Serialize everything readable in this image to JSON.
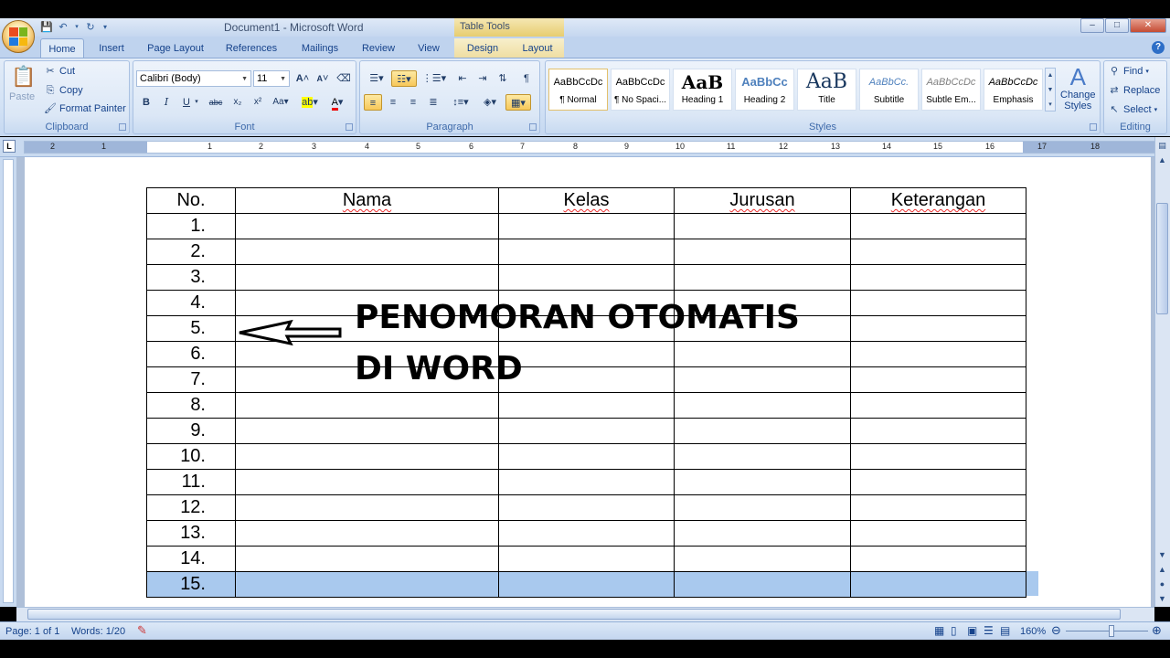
{
  "window": {
    "title_doc": "Document1",
    "title_sep": " - ",
    "title_app": "Microsoft Word",
    "table_tools": "Table Tools",
    "minimize": "–",
    "maximize": "□",
    "close": "✕"
  },
  "tabs": [
    "Home",
    "Insert",
    "Page Layout",
    "References",
    "Mailings",
    "Review",
    "View",
    "Design",
    "Layout"
  ],
  "clipboard": {
    "paste": "Paste",
    "cut": "Cut",
    "copy": "Copy",
    "format_painter": "Format Painter",
    "label": "Clipboard"
  },
  "font": {
    "name": "Calibri (Body)",
    "size": "11",
    "label": "Font"
  },
  "paragraph": {
    "label": "Paragraph"
  },
  "styles": {
    "label": "Styles",
    "items": [
      {
        "sample": "AaBbCcDc",
        "name": "¶ Normal"
      },
      {
        "sample": "AaBbCcDc",
        "name": "¶ No Spaci..."
      },
      {
        "sample": "AaB",
        "name": "Heading 1"
      },
      {
        "sample": "AaBbCc",
        "name": "Heading 2"
      },
      {
        "sample": "AaB",
        "name": "Title"
      },
      {
        "sample": "AaBbCc.",
        "name": "Subtitle"
      },
      {
        "sample": "AaBbCcDc",
        "name": "Subtle Em..."
      },
      {
        "sample": "AaBbCcDc",
        "name": "Emphasis"
      }
    ],
    "change_styles_1": "Change",
    "change_styles_2": "Styles"
  },
  "editing": {
    "find": "Find",
    "replace": "Replace",
    "select": "Select",
    "label": "Editing"
  },
  "ruler": {
    "numbers": [
      "2",
      "1",
      "1",
      "2",
      "3",
      "4",
      "5",
      "6",
      "7",
      "8",
      "9",
      "10",
      "11",
      "12",
      "13",
      "14",
      "15",
      "16",
      "17",
      "18"
    ],
    "corner": "L"
  },
  "table": {
    "headers": [
      "No.",
      "Nama",
      "Kelas",
      "Jurusan",
      "Keterangan"
    ],
    "rows": [
      "1.",
      "2.",
      "3.",
      "4.",
      "5.",
      "6.",
      "7.",
      "8.",
      "9.",
      "10.",
      "11.",
      "12.",
      "13.",
      "14.",
      "15."
    ]
  },
  "overlay": {
    "line1": "PENOMORAN OTOMATIS",
    "line2": "DI WORD"
  },
  "status": {
    "page": "Page: 1 of 1",
    "words": "Words: 1/20",
    "zoom": "160%"
  }
}
